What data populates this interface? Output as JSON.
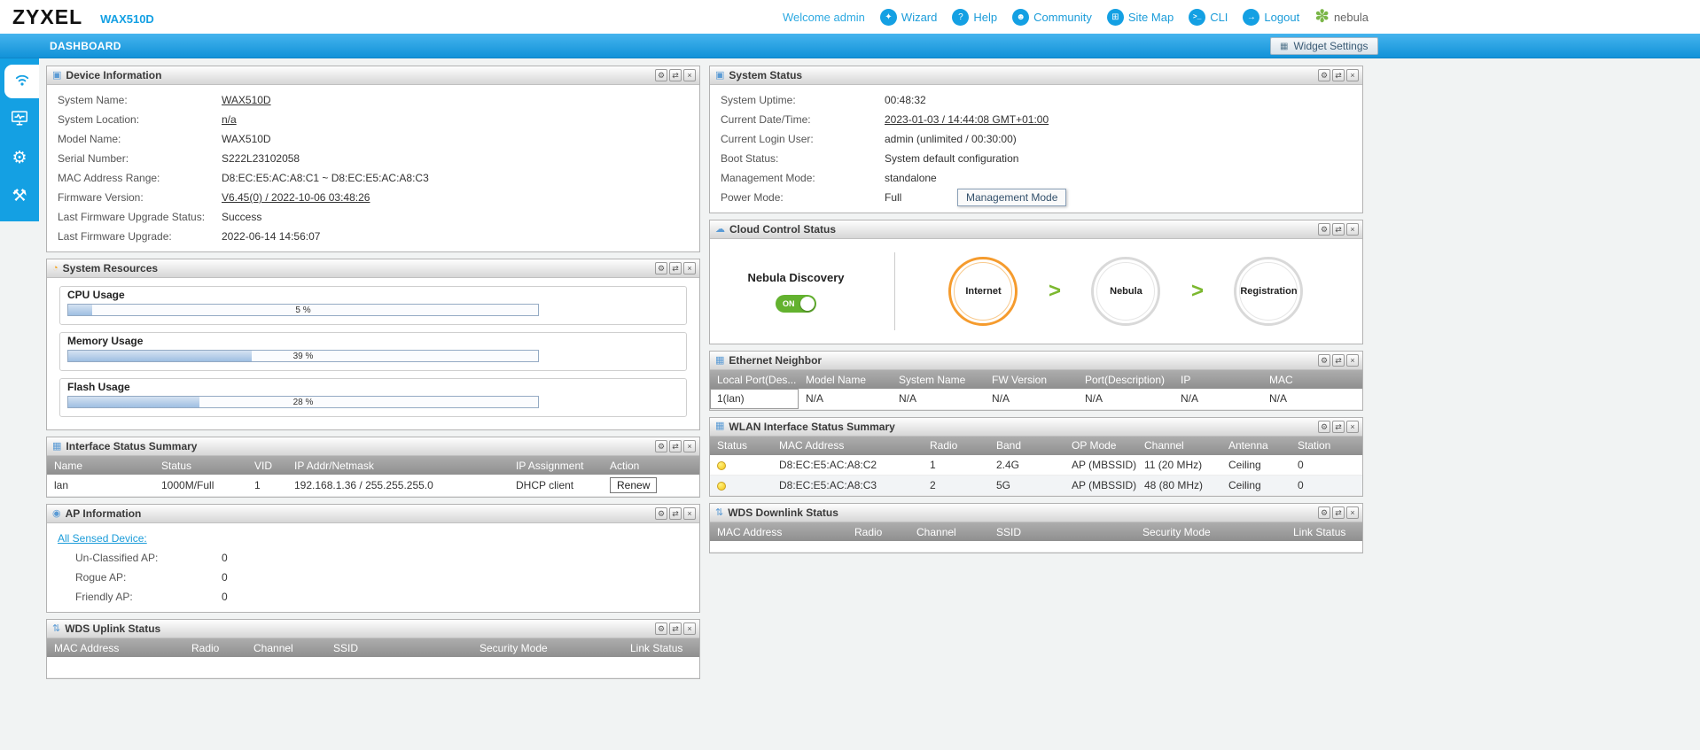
{
  "icons": {
    "wizard": "✦",
    "help": "?",
    "community": "☻",
    "sitemap": "⊞",
    "cli": ">_",
    "logout": "→",
    "nebula": "✽",
    "widget": "▦",
    "settings": "⚙",
    "refresh": "⇄",
    "close": "×",
    "arrow": ">",
    "gear_sidebar": "⚙",
    "maintenance_sidebar": "⚒",
    "panel_device": "▣",
    "panel_resources": "◔",
    "panel_interface": "▦",
    "panel_ap": "◉",
    "panel_wds": "⇅",
    "panel_system": "▣",
    "panel_cloud": "☁",
    "panel_ethernet": "▦",
    "panel_wlan": "▦"
  },
  "header": {
    "logo": "ZYXEL",
    "model": "WAX510D",
    "welcome": "Welcome admin",
    "nav": [
      {
        "label": "Wizard"
      },
      {
        "label": "Help"
      },
      {
        "label": "Community"
      },
      {
        "label": "Site Map"
      },
      {
        "label": "CLI"
      },
      {
        "label": "Logout"
      },
      {
        "label": "nebula"
      }
    ]
  },
  "breadcrumb": {
    "title": "DASHBOARD",
    "widget_settings": "Widget Settings"
  },
  "panels": {
    "device_information": {
      "title": "Device Information",
      "rows": [
        {
          "label": "System Name:",
          "value": "WAX510D"
        },
        {
          "label": "System Location:",
          "value": "n/a"
        },
        {
          "label": "Model Name:",
          "value": "WAX510D"
        },
        {
          "label": "Serial Number:",
          "value": "S222L23102058"
        },
        {
          "label": "MAC Address Range:",
          "value": "D8:EC:E5:AC:A8:C1 ~ D8:EC:E5:AC:A8:C3"
        },
        {
          "label": "Firmware Version:",
          "value": "V6.45(0) / 2022-10-06 03:48:26"
        },
        {
          "label": "Last Firmware Upgrade Status:",
          "value": "Success"
        },
        {
          "label": "Last Firmware Upgrade:",
          "value": "2022-06-14 14:56:07"
        }
      ]
    },
    "system_resources": {
      "title": "System Resources",
      "meters": [
        {
          "label": "CPU Usage",
          "value": 5,
          "text": "5 %"
        },
        {
          "label": "Memory Usage",
          "value": 39,
          "text": "39 %"
        },
        {
          "label": "Flash Usage",
          "value": 28,
          "text": "28 %"
        }
      ]
    },
    "interface_status": {
      "title": "Interface Status Summary",
      "headers": [
        "Name",
        "Status",
        "VID",
        "IP Addr/Netmask",
        "IP Assignment",
        "Action"
      ],
      "rows": [
        [
          "lan",
          "1000M/Full",
          "1",
          "192.168.1.36 / 255.255.255.0",
          "DHCP client",
          "Renew"
        ]
      ]
    },
    "ap_information": {
      "title": "AP Information",
      "link": "All Sensed Device:",
      "rows": [
        {
          "label": "Un-Classified AP:",
          "value": "0"
        },
        {
          "label": "Rogue AP:",
          "value": "0"
        },
        {
          "label": "Friendly AP:",
          "value": "0"
        }
      ]
    },
    "wds_uplink": {
      "title": "WDS Uplink Status",
      "headers": [
        "MAC Address",
        "Radio",
        "Channel",
        "SSID",
        "Security Mode",
        "Link Status"
      ]
    },
    "system_status": {
      "title": "System Status",
      "rows": [
        {
          "label": "System Uptime:",
          "value": "00:48:32"
        },
        {
          "label": "Current Date/Time:",
          "value": "2023-01-03 / 14:44:08 GMT+01:00"
        },
        {
          "label": "Current Login User:",
          "value": "admin (unlimited / 00:30:00)"
        },
        {
          "label": "Boot Status:",
          "value": "System default configuration"
        },
        {
          "label": "Management Mode:",
          "value": "standalone"
        },
        {
          "label": "Power Mode:",
          "value": "Full"
        }
      ],
      "tooltip": "Management Mode"
    },
    "cloud_control": {
      "title": "Cloud Control Status",
      "discovery_label": "Nebula Discovery",
      "toggle": "ON",
      "steps": [
        "Internet",
        "Nebula",
        "Registration"
      ]
    },
    "ethernet_neighbor": {
      "title": "Ethernet Neighbor",
      "headers": [
        "Local Port(Des...",
        "Model Name",
        "System Name",
        "FW Version",
        "Port(Description)",
        "IP",
        "MAC"
      ],
      "rows": [
        [
          "1(lan)",
          "N/A",
          "N/A",
          "N/A",
          "N/A",
          "N/A",
          "N/A"
        ]
      ]
    },
    "wlan_interface": {
      "title": "WLAN Interface Status Summary",
      "headers": [
        "Status",
        "MAC Address",
        "Radio",
        "Band",
        "OP Mode",
        "Channel",
        "Antenna",
        "Station"
      ],
      "rows": [
        [
          "D8:EC:E5:AC:A8:C2",
          "1",
          "2.4G",
          "AP (MBSSID)",
          "11 (20 MHz)",
          "Ceiling",
          "0"
        ],
        [
          "D8:EC:E5:AC:A8:C3",
          "2",
          "5G",
          "AP (MBSSID)",
          "48 (80 MHz)",
          "Ceiling",
          "0"
        ]
      ]
    },
    "wds_downlink": {
      "title": "WDS Downlink Status",
      "headers": [
        "MAC Address",
        "Radio",
        "Channel",
        "SSID",
        "Security Mode",
        "Link Status"
      ]
    }
  }
}
